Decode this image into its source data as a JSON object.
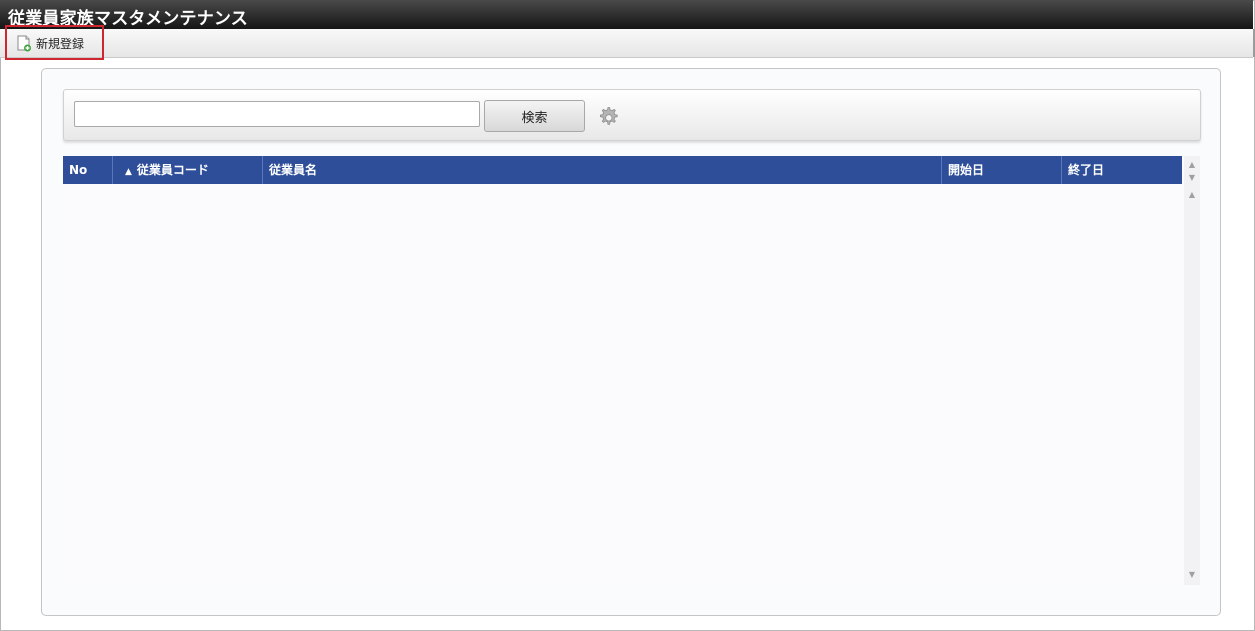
{
  "window": {
    "title": "従業員家族マスタメンテナンス"
  },
  "toolbar": {
    "new_label": "新規登録"
  },
  "search": {
    "value": "",
    "button_label": "検索"
  },
  "table": {
    "sort_indicator": "▲",
    "columns": [
      "No",
      "従業員コード",
      "従業員名",
      "開始日",
      "終了日"
    ],
    "rows": []
  },
  "colors": {
    "header_bg": "#2e4e9a",
    "title_bg": "#1e1e1e",
    "highlight": "#d0262f"
  }
}
